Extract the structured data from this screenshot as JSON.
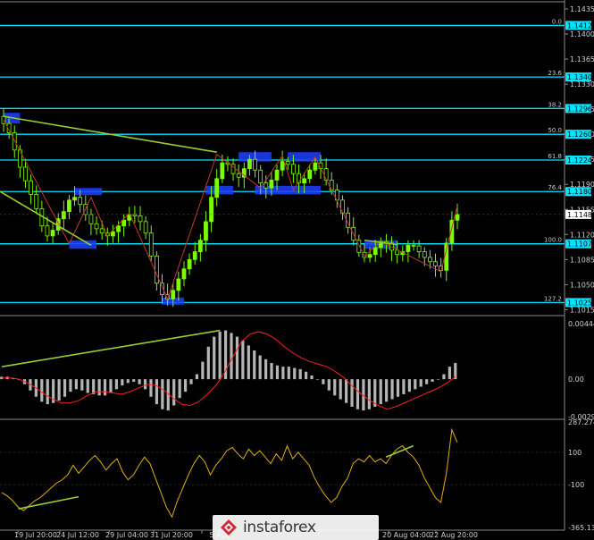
{
  "chart_data": [
    {
      "type": "line",
      "panel": "price",
      "instrument": "EURUSD",
      "price_scale": [
        "1.1435",
        "1.1400",
        "1.1365",
        "1.1330",
        "1.1295",
        "1.1260",
        "1.1225",
        "1.1190",
        "1.1155",
        "1.1120",
        "1.1085",
        "1.1050",
        "1.1015"
      ],
      "ylim": [
        1.1008,
        1.1445
      ],
      "fib_levels": [
        {
          "label": "0.0",
          "value": "1.1412",
          "price": 1.1412
        },
        {
          "label": "23.6",
          "value": "1.1340",
          "price": 1.134
        },
        {
          "label": "38.2",
          "value": "1.1296",
          "price": 1.1296
        },
        {
          "label": "50.0",
          "value": "1.1260",
          "price": 1.126
        },
        {
          "label": "61.8",
          "value": "1.1224",
          "price": 1.1224
        },
        {
          "label": "76.4",
          "value": "1.1180",
          "price": 1.118
        },
        {
          "label": "100.0",
          "value": "1.1107",
          "price": 1.1107
        },
        {
          "label": "127.2",
          "value": "1.1025",
          "price": 1.1025
        }
      ],
      "current_price": "1.1148",
      "close_series": [
        1.1275,
        1.1262,
        1.1238,
        1.1214,
        1.1195,
        1.1176,
        1.1156,
        1.1132,
        1.1118,
        1.1126,
        1.1142,
        1.1152,
        1.1168,
        1.1172,
        1.1162,
        1.1148,
        1.1135,
        1.1128,
        1.1122,
        1.1118,
        1.1124,
        1.1132,
        1.114,
        1.1148,
        1.1146,
        1.1138,
        1.1122,
        1.109,
        1.1052,
        1.1036,
        1.103,
        1.1042,
        1.1058,
        1.1072,
        1.1085,
        1.1096,
        1.1112,
        1.1138,
        1.1172,
        1.1198,
        1.122,
        1.1218,
        1.1205,
        1.12,
        1.1212,
        1.1225,
        1.121,
        1.1192,
        1.1185,
        1.1196,
        1.121,
        1.1222,
        1.1218,
        1.1205,
        1.1192,
        1.1198,
        1.121,
        1.122,
        1.1212,
        1.1196,
        1.1182,
        1.1168,
        1.115,
        1.113,
        1.1112,
        1.1095,
        1.1088,
        1.1092,
        1.1102,
        1.111,
        1.1108,
        1.1098,
        1.1092,
        1.1096,
        1.1105,
        1.1104,
        1.1096,
        1.1088,
        1.1082,
        1.1076,
        1.107,
        1.1108,
        1.114,
        1.1148
      ],
      "zigzag": [
        1.128,
        1.1107,
        1.1172,
        1.1118,
        1.115,
        1.103,
        1.1232,
        1.1185,
        1.123,
        1.1182,
        1.1228,
        1.109,
        1.111,
        1.1068,
        1.116
      ],
      "channel_line": [
        1.1285,
        1.1235
      ]
    },
    {
      "type": "bar",
      "panel": "macd",
      "indicator": "MACD",
      "scale": [
        "0.00444",
        "0.00",
        "-0.00299"
      ],
      "ylim": [
        -0.00299,
        0.00444
      ],
      "histogram": [
        0.0002,
        0.0002,
        0.0001,
        0.0,
        -0.0004,
        -0.0009,
        -0.0014,
        -0.0018,
        -0.002,
        -0.0019,
        -0.0017,
        -0.0014,
        -0.001,
        -0.0008,
        -0.0009,
        -0.0011,
        -0.0012,
        -0.0013,
        -0.0013,
        -0.0011,
        -0.0008,
        -0.0005,
        -0.0003,
        -0.0002,
        -0.0004,
        -0.0008,
        -0.0014,
        -0.002,
        -0.0024,
        -0.0025,
        -0.0021,
        -0.0015,
        -0.001,
        -0.0004,
        0.0004,
        0.0014,
        0.0026,
        0.0034,
        0.0038,
        0.0039,
        0.0037,
        0.0034,
        0.0031,
        0.0027,
        0.0023,
        0.0019,
        0.0016,
        0.0013,
        0.0011,
        0.001,
        0.001,
        0.0009,
        0.0008,
        0.0006,
        0.0003,
        0.0,
        -0.0004,
        -0.0009,
        -0.0013,
        -0.0016,
        -0.0019,
        -0.0022,
        -0.0024,
        -0.0025,
        -0.0024,
        -0.0022,
        -0.002,
        -0.0018,
        -0.0016,
        -0.0014,
        -0.0012,
        -0.001,
        -0.0008,
        -0.0006,
        -0.0004,
        -0.0002,
        0.0,
        0.0004,
        0.001,
        0.0013
      ],
      "signal": [
        0.0001,
        0.0001,
        0.0,
        -0.0003,
        -0.0007,
        -0.0012,
        -0.0016,
        -0.0019,
        -0.0019,
        -0.0017,
        -0.0013,
        -0.001,
        -0.001,
        -0.0011,
        -0.0012,
        -0.001,
        -0.0007,
        -0.0004,
        -0.0005,
        -0.0009,
        -0.0015,
        -0.002,
        -0.0021,
        -0.0018,
        -0.0012,
        -0.0005,
        0.0005,
        0.0018,
        0.003,
        0.0036,
        0.0038,
        0.0036,
        0.0032,
        0.0026,
        0.0021,
        0.0017,
        0.0014,
        0.0012,
        0.001,
        0.0006,
        0.0001,
        -0.0006,
        -0.0012,
        -0.0017,
        -0.0021,
        -0.0024,
        -0.0022,
        -0.0019,
        -0.0016,
        -0.0013,
        -0.001,
        -0.0007,
        -0.0003,
        0.0002
      ],
      "divergence_line": [
        0.001,
        0.0039
      ]
    },
    {
      "type": "line",
      "panel": "cci",
      "indicator": "CCI",
      "scale": [
        "287.2748",
        "100",
        "-100",
        "-365.1301"
      ],
      "ylim": [
        -365.13,
        287.27
      ],
      "values": [
        -150,
        -170,
        -200,
        -240,
        -260,
        -230,
        -200,
        -180,
        -150,
        -120,
        -90,
        -70,
        -40,
        20,
        -30,
        10,
        50,
        80,
        40,
        -10,
        30,
        60,
        -20,
        -70,
        -40,
        20,
        70,
        30,
        -60,
        -150,
        -240,
        -300,
        -200,
        -120,
        -40,
        30,
        80,
        40,
        -40,
        20,
        60,
        110,
        130,
        90,
        60,
        120,
        80,
        110,
        70,
        30,
        90,
        50,
        140,
        60,
        100,
        60,
        20,
        -60,
        -120,
        -170,
        -210,
        -180,
        -110,
        -60,
        30,
        60,
        40,
        80,
        40,
        60,
        30,
        80,
        120,
        140,
        100,
        70,
        20,
        -60,
        -120,
        -180,
        -210,
        -30,
        240,
        160
      ],
      "divergence_line": [
        -250,
        -175
      ],
      "divergence_line_2": [
        70,
        140
      ]
    }
  ],
  "time_axis": [
    "19 Jul 20:00",
    "24 Jul 12:00",
    "29 Jul 04:00",
    "31 Jul 20:00",
    "5 Aug",
    "20 Aug 04:00",
    "22 Aug 20:00"
  ],
  "watermark": "instaforex",
  "colors": {
    "background": "#000000",
    "candles": "#7cfc00",
    "fib": "#00e5ff",
    "zigzag": "#c0392b",
    "trendline": "#9acd32",
    "highlight_box": "#1e40ff",
    "macd_hist": "#b5b5b5",
    "macd_signal": "#ff2020",
    "cci": "#e0b000"
  }
}
